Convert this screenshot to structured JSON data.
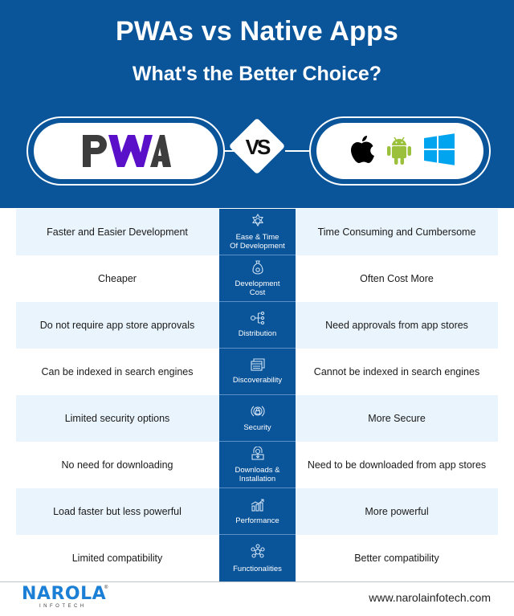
{
  "header": {
    "title": "PWAs vs Native Apps",
    "subtitle": "What's the Better Choice?",
    "left_logo": "PWA",
    "vs_label": "VS",
    "right_icons": [
      "apple-icon",
      "android-icon",
      "windows-icon"
    ]
  },
  "colors": {
    "primary_blue": "#0a5499",
    "row_shade": "#eaf4fc",
    "pwa_dark": "#3d3d3d",
    "pwa_purple": "#5a0fc8",
    "android_green": "#9bc13c",
    "windows_blue": "#00a4ef",
    "logo_blue": "#1b7fd6"
  },
  "comparison": {
    "rows": [
      {
        "pwa": "Faster and Easier Development",
        "criterion": "Ease & Time\nOf Development",
        "icon": "atom-gear-icon",
        "native": "Time Consuming and Cumbersome"
      },
      {
        "pwa": "Cheaper",
        "criterion": "Development\nCost",
        "icon": "money-bag-icon",
        "native": "Often Cost More"
      },
      {
        "pwa": "Do not require app store approvals",
        "criterion": "Distribution",
        "icon": "network-distribution-icon",
        "native": "Need approvals from app stores"
      },
      {
        "pwa": "Can be indexed in search engines",
        "criterion": "Discoverability",
        "icon": "browser-window-icon",
        "native": "Cannot be indexed in search engines"
      },
      {
        "pwa": "Limited security options",
        "criterion": "Security",
        "icon": "lock-shield-icon",
        "native": "More Secure"
      },
      {
        "pwa": "No need for downloading",
        "criterion": "Downloads &\nInstallation",
        "icon": "user-download-icon",
        "native": "Need to be downloaded from app stores"
      },
      {
        "pwa": "Load faster but less powerful",
        "criterion": "Performance",
        "icon": "growth-chart-icon",
        "native": "More powerful"
      },
      {
        "pwa": "Limited compatibility",
        "criterion": "Functionalities",
        "icon": "gear-network-icon",
        "native": "Better compatibility"
      }
    ]
  },
  "footer": {
    "logo_name": "NAROLA",
    "logo_sub": "INFOTECH",
    "logo_reg": "®",
    "url": "www.narolainfotech.com"
  }
}
